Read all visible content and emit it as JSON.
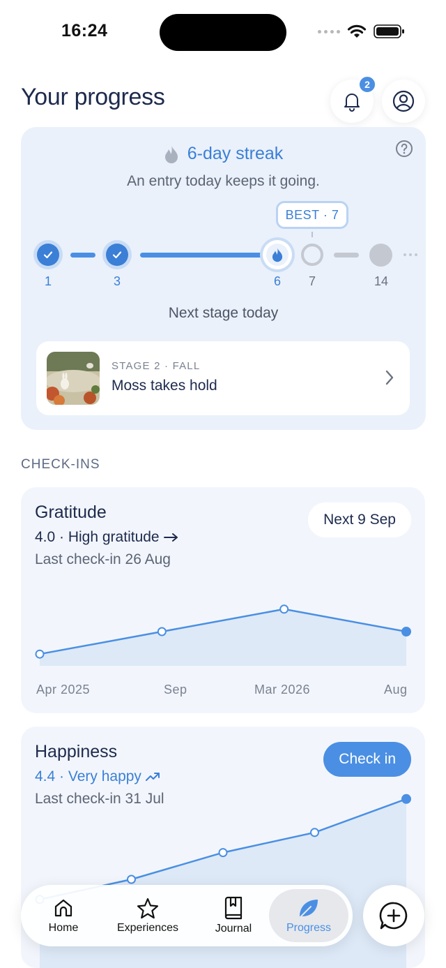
{
  "status_bar": {
    "time": "16:24"
  },
  "header": {
    "title": "Your progress",
    "notification_count": "2"
  },
  "streak": {
    "title": "6-day streak",
    "subtitle": "An entry today keeps it going.",
    "best_label": "BEST · 7",
    "milestones": [
      {
        "label": "1",
        "state": "done"
      },
      {
        "label": "3",
        "state": "done"
      },
      {
        "label": "6",
        "state": "current"
      },
      {
        "label": "7",
        "state": "next"
      },
      {
        "label": "14",
        "state": "locked"
      }
    ],
    "next_stage_text": "Next stage today",
    "stage": {
      "kicker": "STAGE 2 · FALL",
      "name": "Moss takes hold"
    }
  },
  "checkins": {
    "section_label": "CHECK-INS",
    "cards": [
      {
        "title": "Gratitude",
        "score": "4.0 · High gratitude",
        "trend_icon": "arrow-right-icon",
        "last": "Last check-in 26 Aug",
        "action": "Next 9 Sep",
        "x_labels": [
          "Apr 2025",
          "Sep",
          "Mar 2026",
          "Aug"
        ],
        "values": [
          3.6,
          3.75,
          3.9,
          3.75
        ]
      },
      {
        "title": "Happiness",
        "score": "4.4 · Very happy",
        "trend_icon": "trending-up-icon",
        "last": "Last check-in 31 Jul",
        "action": "Check in",
        "values": [
          3.6,
          3.75,
          3.95,
          4.1,
          4.35
        ]
      }
    ]
  },
  "nav": {
    "items": [
      {
        "label": "Home",
        "icon": "home-icon"
      },
      {
        "label": "Experiences",
        "icon": "star-icon"
      },
      {
        "label": "Journal",
        "icon": "journal-icon"
      },
      {
        "label": "Progress",
        "icon": "leaf-icon",
        "active": true
      }
    ],
    "fab_icon": "chat-plus-icon"
  },
  "colors": {
    "accent": "#4a8fe3",
    "text": "#1d2a4d",
    "card": "#eaf1fb"
  }
}
